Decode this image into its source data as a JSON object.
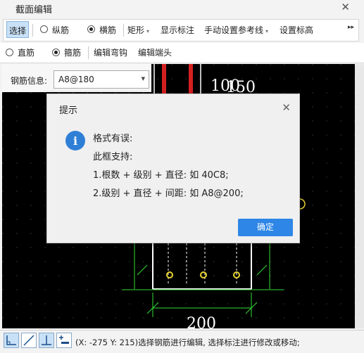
{
  "window": {
    "title": "截面编辑"
  },
  "toolbar1": {
    "select_label": "选择",
    "radio_longitudinal": "纵筋",
    "radio_transverse": "横筋",
    "rect_label": "矩形",
    "show_dim_label": "显示标注",
    "manual_ref_label": "手动设置参考线",
    "set_elev_label": "设置标高",
    "overflow": "▸▸"
  },
  "toolbar2": {
    "radio_straight": "直筋",
    "radio_stirrup": "箍筋",
    "edit_hook_label": "编辑弯钩",
    "edit_end_label": "编辑端头"
  },
  "rebar_info": {
    "label": "钢筋信息:",
    "value": "A8@180"
  },
  "canvas": {
    "dim_top_a": "100",
    "dim_top_b": "150",
    "dim_bottom": "200"
  },
  "dialog": {
    "title": "提示",
    "icon": "i",
    "lines": [
      "格式有误:",
      "此框支持:",
      "1.根数 + 级别 + 直径: 如 40C8;",
      "2.级别 + 直径 + 间距: 如 A8@200;"
    ],
    "ok_label": "确定"
  },
  "statusbar": {
    "text": "(X: -275 Y: 215)选择钢筋进行编辑, 选择标注进行修改或移动;"
  },
  "colors": {
    "accent": "#2e86e6",
    "green": "#33dd33",
    "red": "#d42020",
    "yellow": "#e8d230"
  }
}
